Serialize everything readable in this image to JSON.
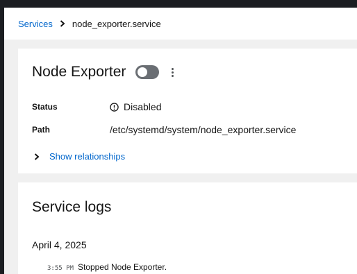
{
  "breadcrumb": {
    "parent": "Services",
    "current": "node_exporter.service"
  },
  "service": {
    "title": "Node Exporter",
    "toggle_enabled": false,
    "status_label": "Status",
    "status_value": "Disabled",
    "path_label": "Path",
    "path_value": "/etc/systemd/system/node_exporter.service",
    "relationships_label": "Show relationships"
  },
  "logs": {
    "title": "Service logs",
    "date": "April 4, 2025",
    "entries": [
      {
        "time": "3:55 PM",
        "message": "Stopped Node Exporter."
      }
    ]
  },
  "colors": {
    "link": "#0066cc",
    "toggle_off": "#6a6e73",
    "page_background": "#f0f0f0",
    "window_chrome": "#1b1d21"
  },
  "icons": {
    "breadcrumb_separator": "chevron-right-icon",
    "toggle_kebab": "kebab-menu-icon",
    "status": "info-circle-icon",
    "expand": "chevron-right-icon"
  }
}
